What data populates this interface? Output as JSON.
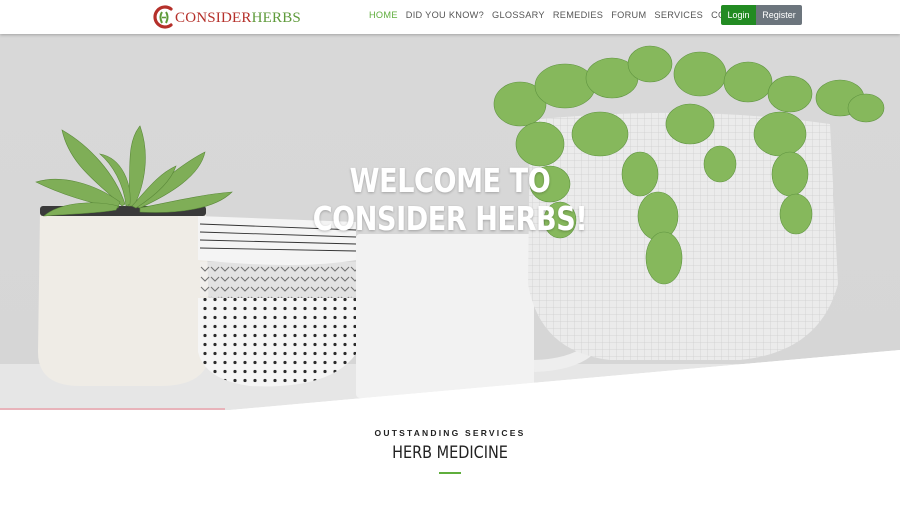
{
  "brand": {
    "logo_text_first": "CONSIDER",
    "logo_text_second": "HERBS",
    "red": "#b5302a",
    "green": "#5e9a3a"
  },
  "nav": {
    "items": [
      {
        "label": "HOME",
        "active": true
      },
      {
        "label": "DID YOU KNOW?",
        "active": false
      },
      {
        "label": "GLOSSARY",
        "active": false
      },
      {
        "label": "REMEDIES",
        "active": false
      },
      {
        "label": "FORUM",
        "active": false
      },
      {
        "label": "SERVICES",
        "active": false
      },
      {
        "label": "CONTACT",
        "active": false
      }
    ],
    "login_label": "Login",
    "register_label": "Register",
    "active_color": "#5fae3c"
  },
  "hero": {
    "title_line1": "WELCOME TO",
    "title_line2": "CONSIDER HERBS!"
  },
  "services": {
    "eyebrow": "OUTSTANDING SERVICES",
    "title": "HERB MEDICINE",
    "accent": "#5fae3c"
  }
}
